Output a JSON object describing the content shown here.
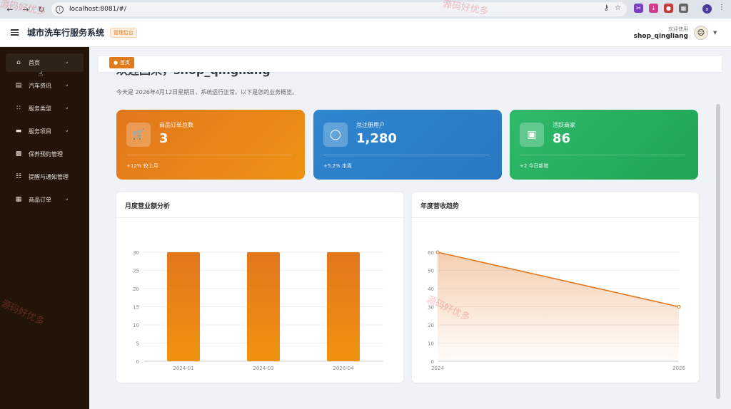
{
  "browser": {
    "url": "localhost:8081/#/"
  },
  "header": {
    "app_title": "城市洗车行服务系统",
    "admin_badge": "管理后台",
    "welcome": "欢迎使用",
    "username": "shop_qingliang"
  },
  "sidebar": {
    "items": [
      {
        "label": "首页",
        "icon": "home-icon"
      },
      {
        "label": "汽车资讯",
        "icon": "wallet-icon"
      },
      {
        "label": "服务类型",
        "icon": "grid-icon"
      },
      {
        "label": "服务项目",
        "icon": "folder-icon"
      },
      {
        "label": "保养预约管理",
        "icon": "calendar-icon"
      },
      {
        "label": "提醒与通知管理",
        "icon": "server-icon"
      },
      {
        "label": "商品订单",
        "icon": "apps-icon"
      }
    ]
  },
  "tags": {
    "home": "首页"
  },
  "main": {
    "welcome_title": "欢迎回来，shop_qingliang",
    "subtitle": "今天是 2026年4月12日星期日，系统运行正常。以下是您的业务概览。"
  },
  "stats": [
    {
      "label": "商品订单总数",
      "value": "3",
      "foot": "+12% 较上月",
      "icon": "cart-icon",
      "color_from": "#e2761c",
      "color_to": "#ee9214"
    },
    {
      "label": "总注册用户",
      "value": "1,280",
      "foot": "+5.2% 本周",
      "icon": "user-icon",
      "color_from": "#2f86cf",
      "color_to": "#2a78c3"
    },
    {
      "label": "活跃商家",
      "value": "86",
      "foot": "+2 今日新增",
      "icon": "store-icon",
      "color_from": "#2fb96a",
      "color_to": "#20a456"
    }
  ],
  "chart_data": [
    {
      "type": "bar",
      "title": "月度营业额分析",
      "categories": [
        "2024-01",
        "2024-03",
        "2026-04"
      ],
      "values": [
        30,
        30,
        30
      ],
      "ylim": [
        0,
        30
      ],
      "yticks": [
        0,
        5,
        10,
        15,
        20,
        25,
        30
      ],
      "grid": true,
      "color_top": "#e2761c",
      "color_bottom": "#f0920f"
    },
    {
      "type": "area",
      "title": "年度营收趋势",
      "x": [
        "2024",
        "2026"
      ],
      "values": [
        60,
        30
      ],
      "ylim": [
        0,
        60
      ],
      "yticks": [
        0,
        10,
        20,
        30,
        40,
        50,
        60
      ],
      "grid": true,
      "color": "#e2761c"
    }
  ],
  "watermark": "源码好优多"
}
